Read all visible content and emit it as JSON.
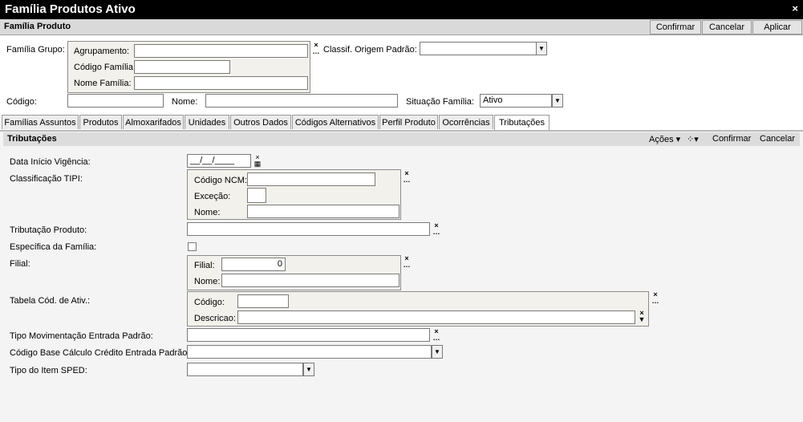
{
  "window": {
    "title": "Família Produtos Ativo",
    "close": "×"
  },
  "header": {
    "title": "Família Produto",
    "confirm": "Confirmar",
    "cancel": "Cancelar",
    "apply": "Aplicar"
  },
  "form": {
    "familia_grupo_label": "Família Grupo:",
    "agrupamento_label": "Agrupamento:",
    "codigo_familia_label": "Código Família:",
    "nome_familia_label": "Nome Família:",
    "classif_label": "Classif. Origem Padrão:",
    "codigo_label": "Código:",
    "nome_label": "Nome:",
    "situacao_label": "Situação Família:",
    "situacao_value": "Ativo"
  },
  "tabs": [
    "Famílias Assuntos",
    "Produtos",
    "Almoxarifados",
    "Unidades",
    "Outros Dados",
    "Códigos Alternativos",
    "Perfil Produto",
    "Ocorrências",
    "Tributações"
  ],
  "tributacoes": {
    "title": "Tributações",
    "acoes": "Ações",
    "confirm": "Confirmar",
    "cancel": "Cancelar",
    "data_inicio_label": "Data Início Vigência:",
    "data_inicio_value": "__/__/____",
    "classif_tipi_label": "Classificação TIPI:",
    "codigo_ncm_label": "Código NCM:",
    "excecao_label": "Exceção:",
    "nome_label": "Nome:",
    "tributacao_produto_label": "Tributação Produto:",
    "especifica_label": "Específica da Família:",
    "filial_label": "Filial:",
    "filial_inner_label": "Filial:",
    "filial_value": "0",
    "filial_nome_label": "Nome:",
    "tabela_label": "Tabela Cód. de Ativ.:",
    "tabela_codigo_label": "Código:",
    "tabela_descricao_label": "Descricao:",
    "tipo_mov_label": "Tipo Movimentação Entrada Padrão:",
    "codigo_base_label": "Código Base Cálculo Crédito Entrada Padrão:",
    "tipo_item_label": "Tipo do Item SPED:"
  }
}
